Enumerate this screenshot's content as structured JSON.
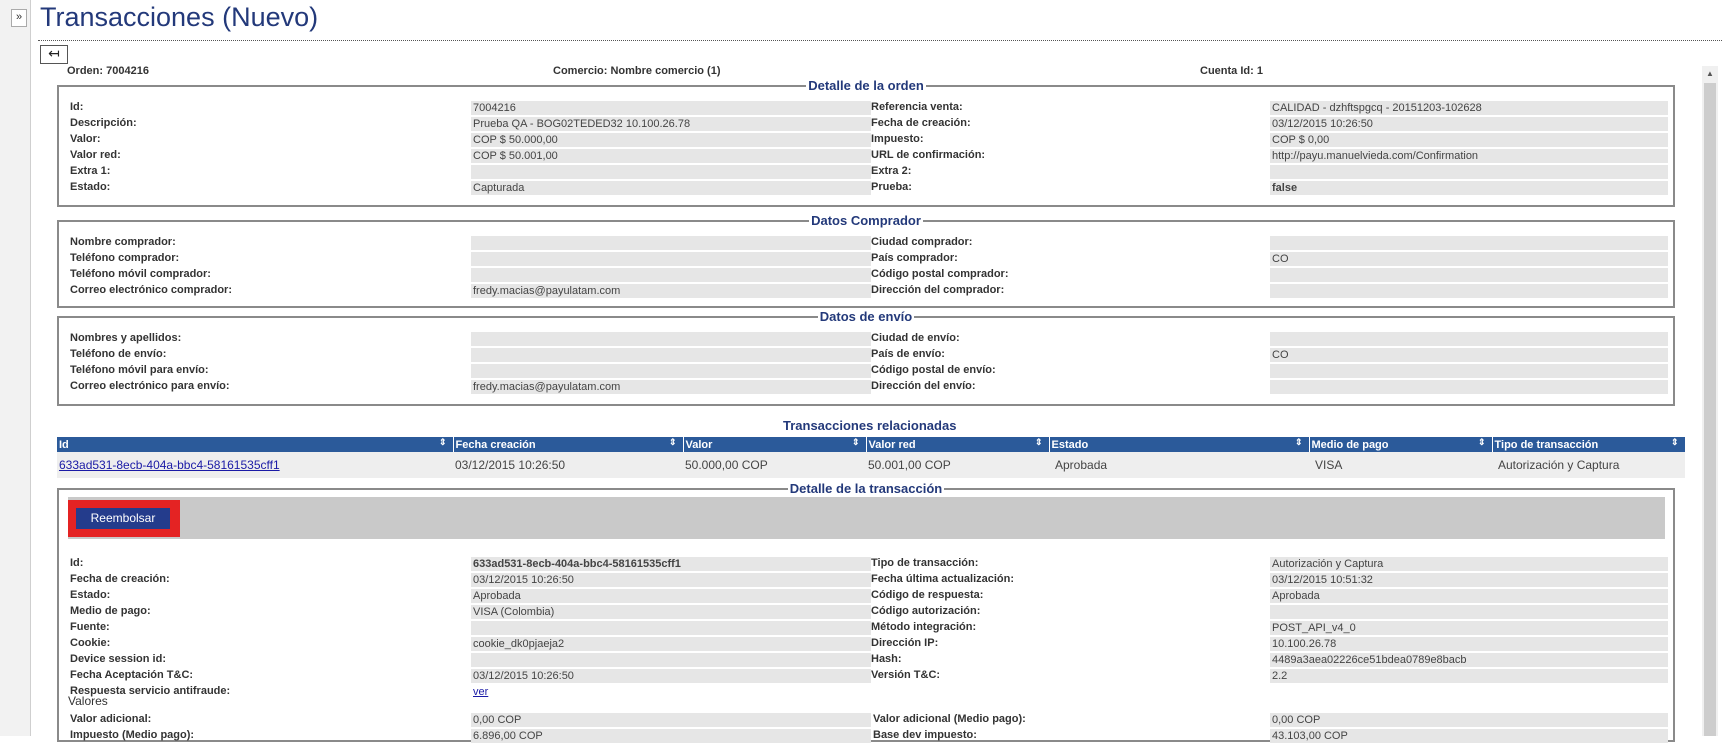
{
  "title": "Transacciones (Nuevo)",
  "expand_glyph": "»",
  "back_glyph": "↤",
  "header": {
    "orden": "Orden: 7004216",
    "comercio": "Comercio: Nombre comercio (1)",
    "cuenta": "Cuenta Id: 1"
  },
  "detalle_orden": {
    "legend": "Detalle de la orden",
    "left": [
      {
        "label": "Id:",
        "value": "7004216"
      },
      {
        "label": "Descripción:",
        "value": "Prueba QA - BOG02TEDED32 10.100.26.78"
      },
      {
        "label": "Valor:",
        "value": "COP $ 50.000,00"
      },
      {
        "label": "Valor red:",
        "value": "COP $ 50.001,00"
      },
      {
        "label": "Extra 1:",
        "value": ""
      },
      {
        "label": "Estado:",
        "value": "Capturada"
      }
    ],
    "right": [
      {
        "label": "Referencia venta:",
        "value": "CALIDAD - dzhftspgcq - 20151203-102628"
      },
      {
        "label": "Fecha de creación:",
        "value": "03/12/2015 10:26:50"
      },
      {
        "label": "Impuesto:",
        "value": "COP $ 0,00"
      },
      {
        "label": "URL de confirmación:",
        "value": "http://payu.manuelvieda.com/Confirmation"
      },
      {
        "label": "Extra 2:",
        "value": ""
      },
      {
        "label": "Prueba:",
        "value": "false"
      }
    ]
  },
  "datos_comprador": {
    "legend": "Datos Comprador",
    "left": [
      {
        "label": "Nombre comprador:",
        "value": ""
      },
      {
        "label": "Teléfono comprador:",
        "value": ""
      },
      {
        "label": "Teléfono móvil comprador:",
        "value": ""
      },
      {
        "label": "Correo electrónico comprador:",
        "value": "fredy.macias@payulatam.com"
      }
    ],
    "right": [
      {
        "label": "Ciudad comprador:",
        "value": ""
      },
      {
        "label": "País comprador:",
        "value": "CO"
      },
      {
        "label": "Código postal comprador:",
        "value": ""
      },
      {
        "label": "Dirección del comprador:",
        "value": ""
      }
    ]
  },
  "datos_envio": {
    "legend": "Datos de envío",
    "left": [
      {
        "label": "Nombres y apellidos:",
        "value": ""
      },
      {
        "label": "Teléfono de envío:",
        "value": ""
      },
      {
        "label": "Teléfono móvil para envío:",
        "value": ""
      },
      {
        "label": "Correo electrónico para envío:",
        "value": "fredy.macias@payulatam.com"
      }
    ],
    "right": [
      {
        "label": "Ciudad de envío:",
        "value": ""
      },
      {
        "label": "País de envío:",
        "value": "CO"
      },
      {
        "label": "Código postal de envío:",
        "value": ""
      },
      {
        "label": "Dirección del envío:",
        "value": ""
      }
    ]
  },
  "related": {
    "title": "Transacciones relacionadas",
    "sort_glyph": "⇕",
    "columns": [
      "Id",
      "Fecha creación",
      "Valor",
      "Valor red",
      "Estado",
      "Medio de pago",
      "Tipo de transacción"
    ],
    "rows": [
      [
        "633ad531-8ecb-404a-bbc4-58161535cff1",
        "03/12/2015 10:26:50",
        "50.000,00 COP",
        "50.001,00 COP",
        "Aprobada",
        "VISA",
        "Autorización y Captura"
      ]
    ]
  },
  "detalle_transaccion": {
    "legend": "Detalle de la transacción",
    "refund_label": "Reembolsar",
    "left": [
      {
        "label": "Id:",
        "value": "633ad531-8ecb-404a-bbc4-58161535cff1"
      },
      {
        "label": "Fecha de creación:",
        "value": "03/12/2015 10:26:50"
      },
      {
        "label": "Estado:",
        "value": "Aprobada"
      },
      {
        "label": "Medio de pago:",
        "value": "VISA (Colombia)"
      },
      {
        "label": "Fuente:",
        "value": ""
      },
      {
        "label": "Cookie:",
        "value": "cookie_dk0pjaeja2"
      },
      {
        "label": "Device session id:",
        "value": ""
      },
      {
        "label": "Fecha Aceptación T&C:",
        "value": "03/12/2015 10:26:50"
      },
      {
        "label": "Respuesta servicio antifraude:",
        "value": "ver"
      }
    ],
    "right": [
      {
        "label": "Tipo de transacción:",
        "value": "Autorización y Captura"
      },
      {
        "label": "Fecha última actualización:",
        "value": "03/12/2015 10:51:32"
      },
      {
        "label": "Código de respuesta:",
        "value": "Aprobada"
      },
      {
        "label": "Código autorización:",
        "value": ""
      },
      {
        "label": "Método integración:",
        "value": "POST_API_v4_0"
      },
      {
        "label": "Dirección IP:",
        "value": "10.100.26.78"
      },
      {
        "label": "Hash:",
        "value": "4489a3aea02226ce51bdea0789e8bacb"
      },
      {
        "label": "Versión T&C:",
        "value": "2.2"
      }
    ],
    "valores_label": "Valores",
    "valores_left": [
      {
        "label": "Valor adicional:",
        "value": "0,00 COP"
      },
      {
        "label": "Impuesto (Medio pago):",
        "value": "6.896,00 COP"
      }
    ],
    "valores_right": [
      {
        "label": "Valor adicional (Medio pago):",
        "value": "0,00 COP"
      },
      {
        "label": "Base dev impuesto:",
        "value": "43.103,00 COP"
      }
    ]
  }
}
